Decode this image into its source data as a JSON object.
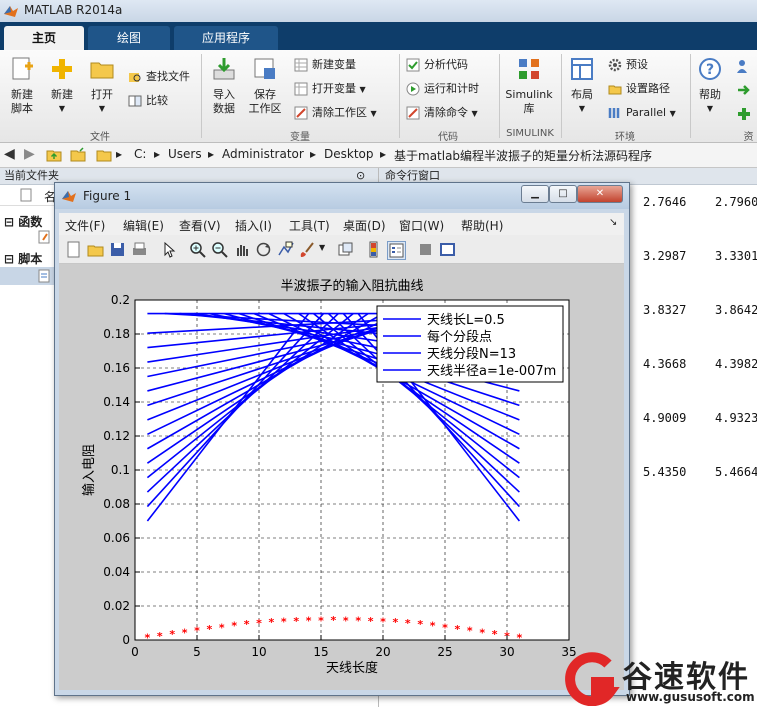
{
  "app": {
    "title": "MATLAB R2014a"
  },
  "tabs": [
    {
      "label": "主页",
      "active": true
    },
    {
      "label": "绘图",
      "active": false
    },
    {
      "label": "应用程序",
      "active": false
    }
  ],
  "ribbon": {
    "file": {
      "label": "文件",
      "new_script": "新建\n脚本",
      "new": "新建",
      "open": "打开",
      "find_files": "查找文件",
      "compare": "比较"
    },
    "variable": {
      "label": "变量",
      "import_data": "导入\n数据",
      "save_workspace": "保存\n工作区",
      "new_variable": "新建变量",
      "open_variable": "打开变量",
      "clear_workspace": "清除工作区"
    },
    "code": {
      "label": "代码",
      "analyze_code": "分析代码",
      "run_and_time": "运行和计时",
      "clear_commands": "清除命令"
    },
    "simulink": {
      "label": "SIMULINK",
      "library": "Simulink\n库"
    },
    "environment": {
      "label": "环境",
      "layout": "布局",
      "preferences": "预设",
      "set_path": "设置路径",
      "parallel": "Parallel"
    },
    "resources": {
      "label": "资",
      "help": "帮助"
    }
  },
  "address": {
    "segments": [
      "C:",
      "Users",
      "Administrator",
      "Desktop",
      "基于matlab编程半波振子的矩量分析法源码程序"
    ]
  },
  "left_panel": {
    "header": "当前文件夹",
    "col_name": "名",
    "group_functions": "函数",
    "group_scripts": "脚本"
  },
  "command_window": {
    "header": "命令行窗口",
    "rows": [
      [
        "2.7646",
        "2.7960"
      ],
      [
        "3.2987",
        "3.3301"
      ],
      [
        "3.8327",
        "3.8642"
      ],
      [
        "4.3668",
        "4.3982"
      ],
      [
        "4.9009",
        "4.9323"
      ],
      [
        "5.4350",
        "5.4664"
      ]
    ]
  },
  "figure": {
    "title": "Figure 1",
    "menu": [
      "文件(F)",
      "编辑(E)",
      "查看(V)",
      "插入(I)",
      "工具(T)",
      "桌面(D)",
      "窗口(W)",
      "帮助(H)"
    ]
  },
  "chart_data": {
    "type": "line",
    "title": "半波振子的输入阻抗曲线",
    "xlabel": "天线长度",
    "ylabel": "输入电阻",
    "xlim": [
      0,
      35
    ],
    "ylim": [
      0,
      0.2
    ],
    "xticks": [
      0,
      5,
      10,
      15,
      20,
      25,
      30,
      35
    ],
    "yticks": [
      0,
      0.02,
      0.04,
      0.06,
      0.08,
      0.1,
      0.12,
      0.14,
      0.16,
      0.18,
      0.2
    ],
    "grid": true,
    "grid_style": "dashed",
    "legend_position": "top-right",
    "legend": [
      "天线长L=0.5",
      "每个分段点",
      "天线分段N=13",
      "天线半径a=1e-007m"
    ],
    "series_color": "#0000ff",
    "rising_lines": {
      "count": 14,
      "x_start": 1,
      "x_end_first": 14,
      "x_end_step": 1.2,
      "y_start_first": 0.07,
      "y_start_step": 0.0085,
      "y_end": 0.192
    },
    "falling_lines": {
      "count": 14,
      "x_end": 31,
      "x_start_first": 18,
      "x_start_step": -1.2,
      "y_start": 0.192,
      "y_end_first": 0.07,
      "y_end_step": 0.0085
    },
    "flat_line": {
      "x": [
        1,
        31
      ],
      "y": 0.192
    },
    "points": {
      "color": "#ff0000",
      "marker": "*",
      "x": [
        1,
        2,
        3,
        4,
        5,
        6,
        7,
        8,
        9,
        10,
        11,
        12,
        13,
        14,
        15,
        16,
        17,
        18,
        19,
        20,
        21,
        22,
        23,
        24,
        25,
        26,
        27,
        28,
        29,
        30,
        31
      ],
      "y": [
        0.0015,
        0.0025,
        0.0035,
        0.0045,
        0.0055,
        0.0065,
        0.0075,
        0.0085,
        0.0093,
        0.01,
        0.0105,
        0.011,
        0.0113,
        0.0115,
        0.0116,
        0.0117,
        0.0116,
        0.0115,
        0.0113,
        0.011,
        0.0105,
        0.01,
        0.0093,
        0.0085,
        0.0075,
        0.0065,
        0.0055,
        0.0045,
        0.0035,
        0.0025,
        0.0015
      ]
    }
  },
  "watermark": {
    "brand": "谷速软件",
    "url": "www.gususoft.com"
  }
}
